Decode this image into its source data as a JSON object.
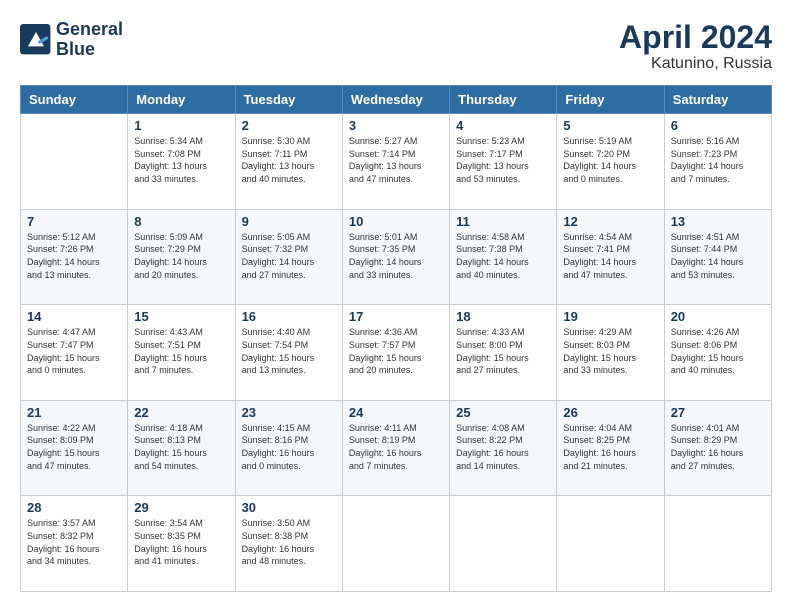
{
  "header": {
    "logo_line1": "General",
    "logo_line2": "Blue",
    "title": "April 2024",
    "location": "Katunino, Russia"
  },
  "days_of_week": [
    "Sunday",
    "Monday",
    "Tuesday",
    "Wednesday",
    "Thursday",
    "Friday",
    "Saturday"
  ],
  "weeks": [
    [
      {
        "day": "",
        "info": ""
      },
      {
        "day": "1",
        "info": "Sunrise: 5:34 AM\nSunset: 7:08 PM\nDaylight: 13 hours\nand 33 minutes."
      },
      {
        "day": "2",
        "info": "Sunrise: 5:30 AM\nSunset: 7:11 PM\nDaylight: 13 hours\nand 40 minutes."
      },
      {
        "day": "3",
        "info": "Sunrise: 5:27 AM\nSunset: 7:14 PM\nDaylight: 13 hours\nand 47 minutes."
      },
      {
        "day": "4",
        "info": "Sunrise: 5:23 AM\nSunset: 7:17 PM\nDaylight: 13 hours\nand 53 minutes."
      },
      {
        "day": "5",
        "info": "Sunrise: 5:19 AM\nSunset: 7:20 PM\nDaylight: 14 hours\nand 0 minutes."
      },
      {
        "day": "6",
        "info": "Sunrise: 5:16 AM\nSunset: 7:23 PM\nDaylight: 14 hours\nand 7 minutes."
      }
    ],
    [
      {
        "day": "7",
        "info": "Sunrise: 5:12 AM\nSunset: 7:26 PM\nDaylight: 14 hours\nand 13 minutes."
      },
      {
        "day": "8",
        "info": "Sunrise: 5:09 AM\nSunset: 7:29 PM\nDaylight: 14 hours\nand 20 minutes."
      },
      {
        "day": "9",
        "info": "Sunrise: 5:05 AM\nSunset: 7:32 PM\nDaylight: 14 hours\nand 27 minutes."
      },
      {
        "day": "10",
        "info": "Sunrise: 5:01 AM\nSunset: 7:35 PM\nDaylight: 14 hours\nand 33 minutes."
      },
      {
        "day": "11",
        "info": "Sunrise: 4:58 AM\nSunset: 7:38 PM\nDaylight: 14 hours\nand 40 minutes."
      },
      {
        "day": "12",
        "info": "Sunrise: 4:54 AM\nSunset: 7:41 PM\nDaylight: 14 hours\nand 47 minutes."
      },
      {
        "day": "13",
        "info": "Sunrise: 4:51 AM\nSunset: 7:44 PM\nDaylight: 14 hours\nand 53 minutes."
      }
    ],
    [
      {
        "day": "14",
        "info": "Sunrise: 4:47 AM\nSunset: 7:47 PM\nDaylight: 15 hours\nand 0 minutes."
      },
      {
        "day": "15",
        "info": "Sunrise: 4:43 AM\nSunset: 7:51 PM\nDaylight: 15 hours\nand 7 minutes."
      },
      {
        "day": "16",
        "info": "Sunrise: 4:40 AM\nSunset: 7:54 PM\nDaylight: 15 hours\nand 13 minutes."
      },
      {
        "day": "17",
        "info": "Sunrise: 4:36 AM\nSunset: 7:57 PM\nDaylight: 15 hours\nand 20 minutes."
      },
      {
        "day": "18",
        "info": "Sunrise: 4:33 AM\nSunset: 8:00 PM\nDaylight: 15 hours\nand 27 minutes."
      },
      {
        "day": "19",
        "info": "Sunrise: 4:29 AM\nSunset: 8:03 PM\nDaylight: 15 hours\nand 33 minutes."
      },
      {
        "day": "20",
        "info": "Sunrise: 4:26 AM\nSunset: 8:06 PM\nDaylight: 15 hours\nand 40 minutes."
      }
    ],
    [
      {
        "day": "21",
        "info": "Sunrise: 4:22 AM\nSunset: 8:09 PM\nDaylight: 15 hours\nand 47 minutes."
      },
      {
        "day": "22",
        "info": "Sunrise: 4:18 AM\nSunset: 8:13 PM\nDaylight: 15 hours\nand 54 minutes."
      },
      {
        "day": "23",
        "info": "Sunrise: 4:15 AM\nSunset: 8:16 PM\nDaylight: 16 hours\nand 0 minutes."
      },
      {
        "day": "24",
        "info": "Sunrise: 4:11 AM\nSunset: 8:19 PM\nDaylight: 16 hours\nand 7 minutes."
      },
      {
        "day": "25",
        "info": "Sunrise: 4:08 AM\nSunset: 8:22 PM\nDaylight: 16 hours\nand 14 minutes."
      },
      {
        "day": "26",
        "info": "Sunrise: 4:04 AM\nSunset: 8:25 PM\nDaylight: 16 hours\nand 21 minutes."
      },
      {
        "day": "27",
        "info": "Sunrise: 4:01 AM\nSunset: 8:29 PM\nDaylight: 16 hours\nand 27 minutes."
      }
    ],
    [
      {
        "day": "28",
        "info": "Sunrise: 3:57 AM\nSunset: 8:32 PM\nDaylight: 16 hours\nand 34 minutes."
      },
      {
        "day": "29",
        "info": "Sunrise: 3:54 AM\nSunset: 8:35 PM\nDaylight: 16 hours\nand 41 minutes."
      },
      {
        "day": "30",
        "info": "Sunrise: 3:50 AM\nSunset: 8:38 PM\nDaylight: 16 hours\nand 48 minutes."
      },
      {
        "day": "",
        "info": ""
      },
      {
        "day": "",
        "info": ""
      },
      {
        "day": "",
        "info": ""
      },
      {
        "day": "",
        "info": ""
      }
    ]
  ]
}
